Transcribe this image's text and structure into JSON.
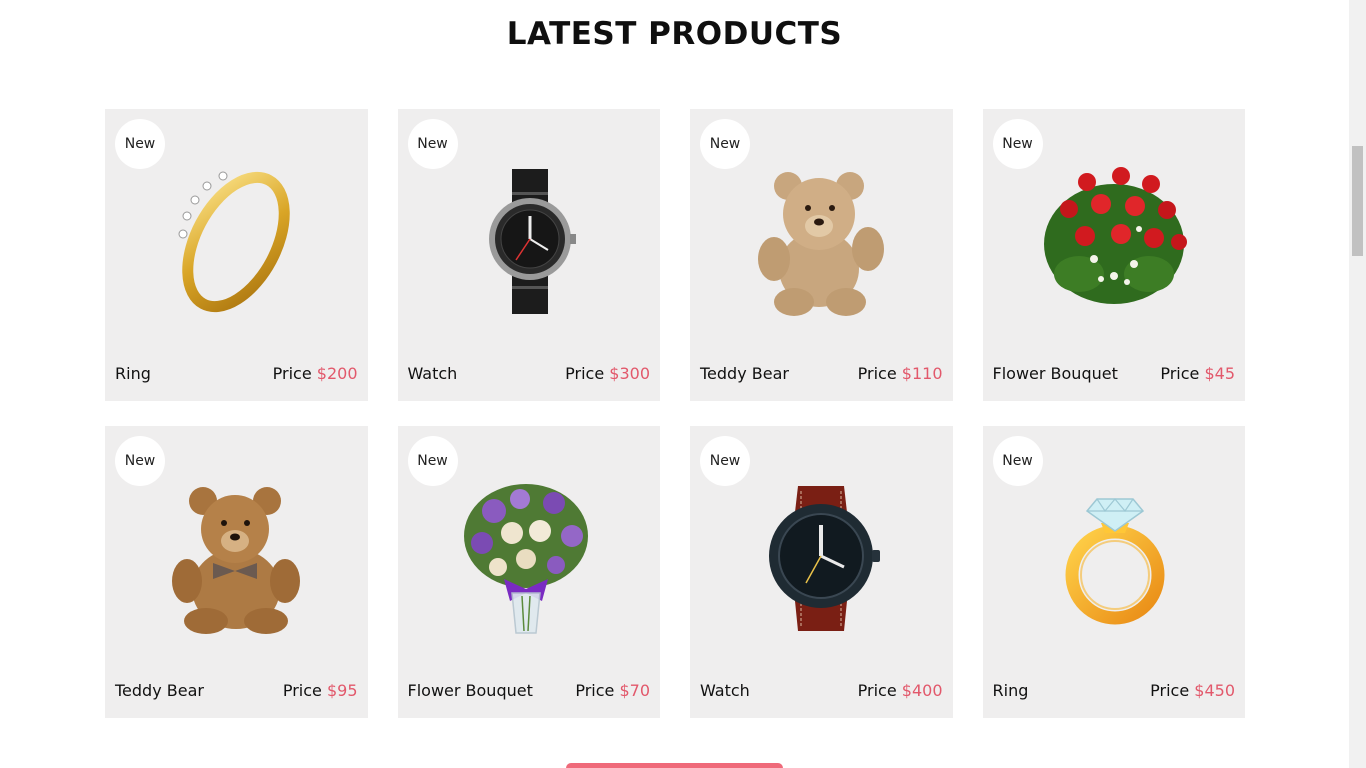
{
  "section": {
    "title": "LATEST PRODUCTS"
  },
  "colors": {
    "accent": "#e2586b",
    "card_bg": "#efeeee",
    "button_bg": "#ef6a7a"
  },
  "products": [
    {
      "badge": "New",
      "name": "Ring",
      "price_label": "Price",
      "price": "$200",
      "image": "gold-ring-with-diamonds"
    },
    {
      "badge": "New",
      "name": "Watch",
      "price_label": "Price",
      "price": "$300",
      "image": "black-strap-wristwatch"
    },
    {
      "badge": "New",
      "name": "Teddy Bear",
      "price_label": "Price",
      "price": "$110",
      "image": "beige-teddy-bear"
    },
    {
      "badge": "New",
      "name": "Flower Bouquet",
      "price_label": "Price",
      "price": "$45",
      "image": "red-rose-bouquet"
    },
    {
      "badge": "New",
      "name": "Teddy Bear",
      "price_label": "Price",
      "price": "$95",
      "image": "brown-teddy-bear-with-bow"
    },
    {
      "badge": "New",
      "name": "Flower Bouquet",
      "price_label": "Price",
      "price": "$70",
      "image": "purple-flower-vase"
    },
    {
      "badge": "New",
      "name": "Watch",
      "price_label": "Price",
      "price": "$400",
      "image": "leather-strap-wristwatch"
    },
    {
      "badge": "New",
      "name": "Ring",
      "price_label": "Price",
      "price": "$450",
      "image": "gold-diamond-ring"
    }
  ]
}
